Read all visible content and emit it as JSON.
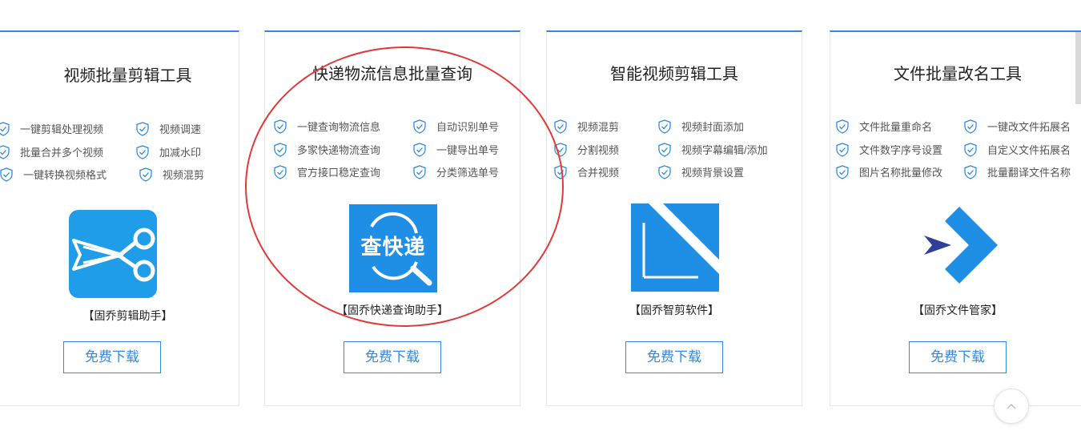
{
  "cards": [
    {
      "title": "视频批量剪辑工具",
      "features": [
        "一键剪辑处理视频",
        "视频调速",
        "批量合并多个视频",
        "加减水印",
        "一键转换视频格式",
        "视频混剪"
      ],
      "logo_icon": "scissors-icon",
      "product": "【固乔剪辑助手】",
      "button": "免费下载"
    },
    {
      "title": "快递物流信息批量查询",
      "features": [
        "一键查询物流信息",
        "自动识别单号",
        "多家快递物流查询",
        "一键导出单号",
        "官方接口稳定查询",
        "分类筛选单号"
      ],
      "logo_icon": "express-search-icon",
      "logo_text": "查快递",
      "product": "【固乔快递查询助手】",
      "button": "免费下载"
    },
    {
      "title": "智能视频剪辑工具",
      "features": [
        "视频混剪",
        "视频封面添加",
        "分割视频",
        "视频字幕编辑/添加",
        "合并视频",
        "视频背景设置"
      ],
      "logo_icon": "smart-cut-icon",
      "product": "【固乔智剪软件】",
      "button": "免费下载"
    },
    {
      "title": "文件批量改名工具",
      "features": [
        "文件批量重命名",
        "一键改文件拓展名",
        "文件数字序号设置",
        "自定义文件拓展名",
        "图片名称批量修改",
        "批量翻译文件名称"
      ],
      "logo_icon": "file-manager-icon",
      "product": "【固乔文件管家】",
      "button": "免费下载"
    }
  ],
  "colors": {
    "accent": "#2f8ae0",
    "highlight_circle": "#e0393a",
    "icon_blue": "#1f8fe6"
  },
  "back_to_top_icon": "chevron-up-icon"
}
